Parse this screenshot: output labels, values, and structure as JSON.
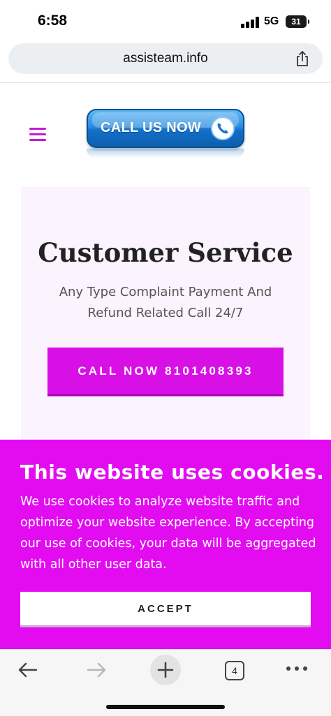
{
  "status_bar": {
    "time": "6:58",
    "network": "5G",
    "battery": "31"
  },
  "browser": {
    "url": "assisteam.info",
    "tab_count": "4",
    "icons": [
      "share-icon",
      "back-arrow-icon",
      "forward-arrow-icon",
      "plus-icon",
      "tabs-icon",
      "more-dots-icon"
    ]
  },
  "header": {
    "banner_text": "CALL US NOW",
    "icons": [
      "hamburger-menu-icon",
      "phone-icon"
    ]
  },
  "hero": {
    "title": "Customer Service",
    "subtitle": "Any Type Complaint Payment And Refund Related Call 24/7",
    "call_button": "CALL NOW 8101408393"
  },
  "cookie_banner": {
    "title": "This website uses cookies.",
    "body": "We use cookies to analyze website traffic and optimize your website experience. By accepting our use of cookies, your data will be aggregated with all other user data.",
    "accept_label": "ACCEPT"
  },
  "colors": {
    "accent_magenta": "#d810e6",
    "cookie_background": "#e30cf1",
    "hero_background": "#fbf3fd",
    "banner_blue": "#126fc8"
  }
}
